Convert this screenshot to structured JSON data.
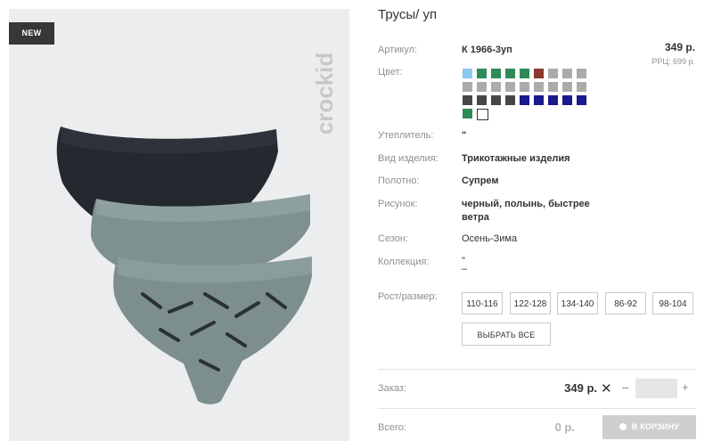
{
  "photo": {
    "badge": "NEW",
    "brand": "crockid"
  },
  "product": {
    "title": "Трусы/ уп",
    "price": "349 р.",
    "rrp": "РРЦ: 699 р."
  },
  "details": {
    "article_label": "Артикул:",
    "article_value": "К 1966-3уп",
    "color_label": "Цвет:",
    "insulation_label": "Утеплитель:",
    "insulation_value": "\"",
    "type_label": "Вид изделия:",
    "type_value": "Трикотажные изделия",
    "fabric_label": "Полотно:",
    "fabric_value": "Супрем",
    "pattern_label": "Рисунок:",
    "pattern_line1": "черный, полынь, быстрее",
    "pattern_line2": "ветра",
    "season_label": "Сезон:",
    "season_value": "Осень-Зима",
    "collection_label": "Коллекция:",
    "collection_line1": "\"",
    "collection_line2": "–"
  },
  "colors": {
    "row1": [
      "#87c9ef",
      "#2e8b57",
      "#2e8b57",
      "#2e8b57",
      "#2e8b57",
      "#8b3a2e",
      "#ababab",
      "#ababab",
      "#ababab"
    ],
    "row2": [
      "#ababab",
      "#ababab",
      "#ababab",
      "#ababab",
      "#ababab",
      "#ababab",
      "#ababab",
      "#ababab",
      "#ababab"
    ],
    "row3": [
      "#474747",
      "#474747",
      "#474747",
      "#474747",
      "#1a1a8c",
      "#1a1a8c",
      "#1a1a8c",
      "#1a1a8c",
      "#1a1a8c"
    ],
    "row4": [
      "#2e8b57",
      "selected"
    ]
  },
  "sizes": {
    "label": "Рост/размер:",
    "options": [
      "110-116",
      "122-128",
      "134-140",
      "86-92",
      "98-104"
    ],
    "select_all": "ВЫБРАТЬ ВСЕ"
  },
  "order": {
    "label": "Заказ:",
    "price": "349 р.",
    "remove_icon": "✕",
    "minus": "–",
    "plus": "+",
    "qty": ""
  },
  "total": {
    "label": "Всего:",
    "value": "0 р.",
    "cart_button": "В КОРЗИНУ"
  }
}
